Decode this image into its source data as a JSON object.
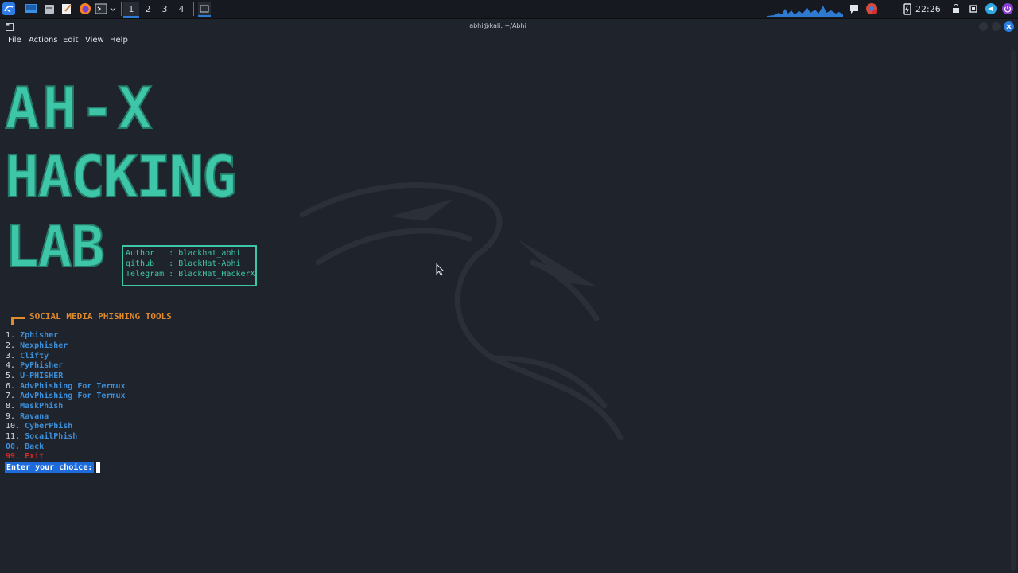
{
  "taskbar": {
    "workspaces": [
      "1",
      "2",
      "3",
      "4"
    ],
    "clock": "22:26",
    "icons": [
      "kali-menu-icon",
      "desktop-icon",
      "file-manager-icon",
      "text-editor-icon",
      "firefox-icon",
      "terminal-icon",
      "window-icon"
    ]
  },
  "window": {
    "title": "abhi@kali: ~/Abhi",
    "menu": [
      "File",
      "Actions",
      "Edit",
      "View",
      "Help"
    ]
  },
  "banner": {
    "line1": "AH-X",
    "line2": "HACKING",
    "line3": "LAB"
  },
  "info": {
    "author": "Author   : blackhat_abhi",
    "github": "github   : BlackHat-Abhi",
    "telegram": "Telegram : BlackHat_HackerX"
  },
  "menu": {
    "title": "SOCIAL MEDIA PHISHING TOOLS",
    "options": [
      {
        "num": "1.",
        "label": "Zphisher"
      },
      {
        "num": "2.",
        "label": "Nexphisher"
      },
      {
        "num": "3.",
        "label": "Clifty"
      },
      {
        "num": "4.",
        "label": "PyPhisher"
      },
      {
        "num": "5.",
        "label": "U-PHISHER"
      },
      {
        "num": "6.",
        "label": "AdvPhishing For Termux"
      },
      {
        "num": "7.",
        "label": "AdvPhishing For Termux"
      },
      {
        "num": "8.",
        "label": "MaskPhish"
      },
      {
        "num": "9.",
        "label": "Ravana"
      },
      {
        "num": "10.",
        "label": "CyberPhish"
      },
      {
        "num": "11.",
        "label": "SocailPhish"
      },
      {
        "num": "00.",
        "label": "Back"
      },
      {
        "num": "99.",
        "label": "Exit"
      }
    ],
    "prompt": "Enter your choice:"
  },
  "colors": {
    "background": "#1f232b",
    "banner": "#3ec6a8",
    "section": "#e08a2c",
    "option": "#3d8fd9",
    "exit": "#d12a2a",
    "prompt_bg": "#1e6cdc"
  }
}
